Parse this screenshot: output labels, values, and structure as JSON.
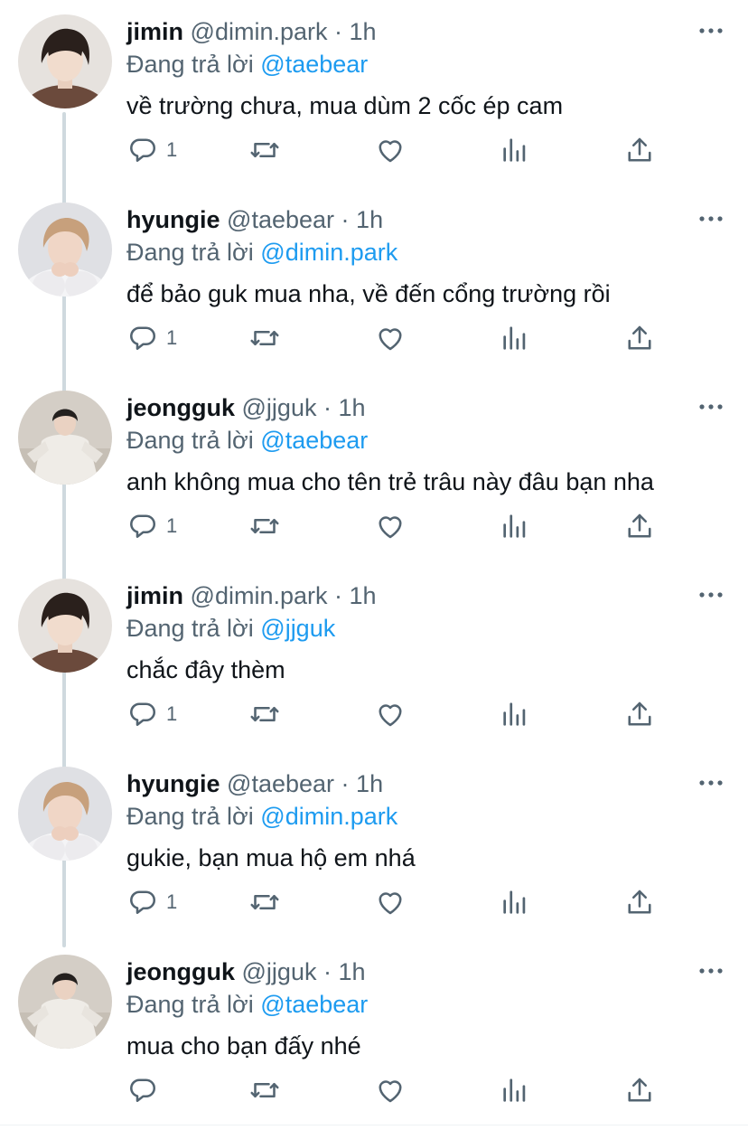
{
  "replying_prefix": "Đang trả lời",
  "tweets": [
    {
      "name": "jimin",
      "handle": "@dimin.park",
      "dot": "·",
      "time": "1h",
      "reply_to": "@taebear",
      "text": "về trường chưa, mua dùm 2 cốc ép cam",
      "reply_count": "1",
      "avatar": "jimin-avatar"
    },
    {
      "name": "hyungie",
      "handle": "@taebear",
      "dot": "·",
      "time": "1h",
      "reply_to": "@dimin.park",
      "text": "để bảo guk mua nha, về đến cổng trường rồi",
      "reply_count": "1",
      "avatar": "hyungie-avatar"
    },
    {
      "name": "jeongguk",
      "handle": "@jjguk",
      "dot": "·",
      "time": "1h",
      "reply_to": "@taebear",
      "text": "anh không mua cho tên trẻ trâu này đâu bạn nha",
      "reply_count": "1",
      "avatar": "jeongguk-avatar"
    },
    {
      "name": "jimin",
      "handle": "@dimin.park",
      "dot": "·",
      "time": "1h",
      "reply_to": "@jjguk",
      "text": "chắc đây thèm",
      "reply_count": "1",
      "avatar": "jimin-avatar"
    },
    {
      "name": "hyungie",
      "handle": "@taebear",
      "dot": "·",
      "time": "1h",
      "reply_to": "@dimin.park",
      "text": "gukie, bạn mua hộ em nhá",
      "reply_count": "1",
      "avatar": "hyungie-avatar"
    },
    {
      "name": "jeongguk",
      "handle": "@jjguk",
      "dot": "·",
      "time": "1h",
      "reply_to": "@taebear",
      "text": "mua cho bạn đấy nhé",
      "reply_count": "",
      "avatar": "jeongguk-avatar"
    }
  ],
  "icons": {
    "reply": "reply-icon",
    "retweet": "retweet-icon",
    "like": "heart-icon",
    "analytics": "analytics-icon",
    "share": "share-icon",
    "more": "more-icon"
  },
  "colors": {
    "name": "#0f1419",
    "muted": "#536471",
    "mention": "#1d9bf0",
    "thread_line": "#cfd9de"
  }
}
